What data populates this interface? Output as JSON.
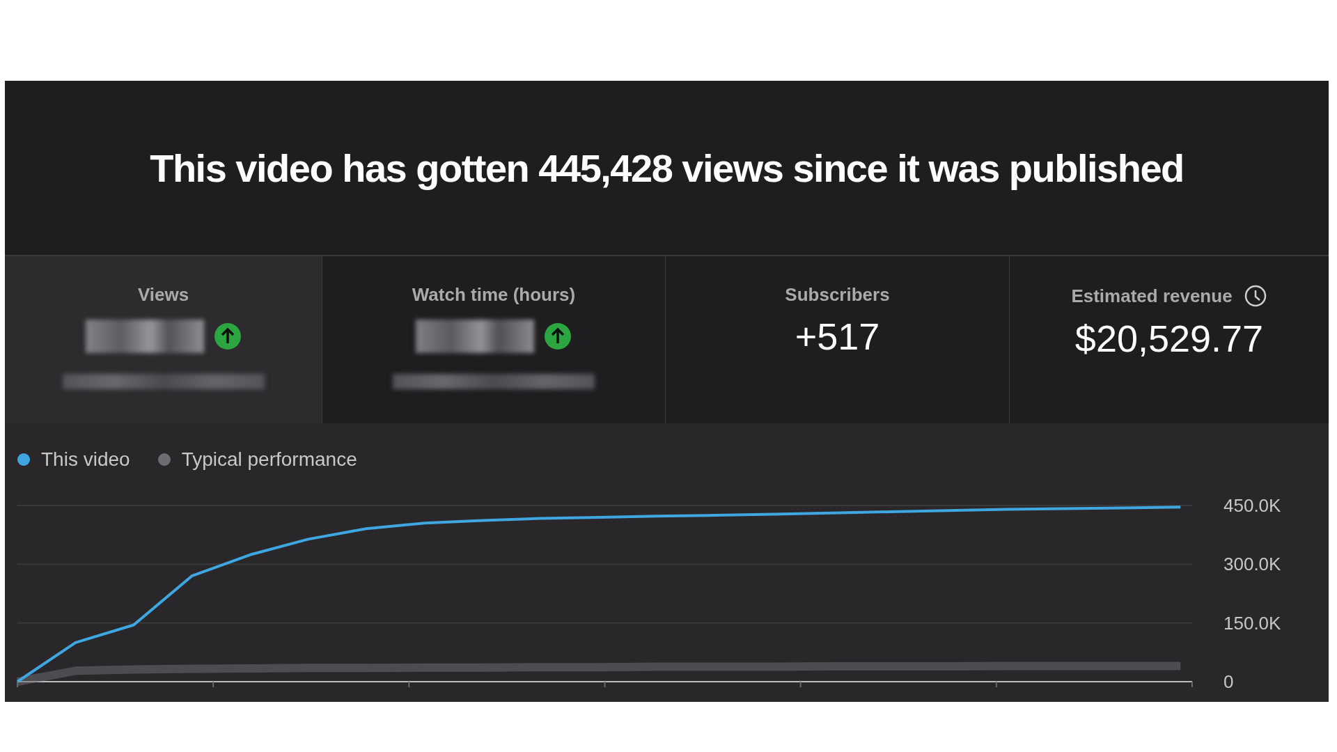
{
  "headline": "This video has gotten 445,428 views since it was published",
  "metrics": [
    {
      "kind": "redacted",
      "label": "Views",
      "selected": true
    },
    {
      "kind": "redacted",
      "label": "Watch time (hours)",
      "selected": false
    },
    {
      "kind": "number",
      "label": "Subscribers",
      "selected": false,
      "value": "+517"
    },
    {
      "kind": "revenue",
      "label": "Estimated revenue",
      "selected": false,
      "value": "$20,529.77"
    }
  ],
  "chart": {
    "chart_data": {
      "type": "line",
      "ylim": [
        0,
        450000
      ],
      "yticks": [
        {
          "value": 0,
          "label": "0"
        },
        {
          "value": 150000,
          "label": "150.0K"
        },
        {
          "value": 300000,
          "label": "300.0K"
        },
        {
          "value": 450000,
          "label": "450.0K"
        }
      ],
      "series": [
        {
          "name": "This video",
          "color": "#3ea6e0",
          "values": [
            0,
            100000,
            145000,
            270000,
            324000,
            364000,
            391000,
            405000,
            412000,
            417000,
            420000,
            423000,
            425000,
            428000,
            431000,
            434000,
            437000,
            440000,
            442000,
            444000,
            446000
          ]
        },
        {
          "name": "Typical performance",
          "color": "#6e6c70",
          "values": [
            0,
            28000,
            31000,
            33000,
            34000,
            35000,
            35000,
            36000,
            36000,
            37000,
            37000,
            38000,
            38000,
            38000,
            39000,
            39000,
            39000,
            40000,
            40000,
            40000,
            40000
          ]
        }
      ]
    }
  }
}
